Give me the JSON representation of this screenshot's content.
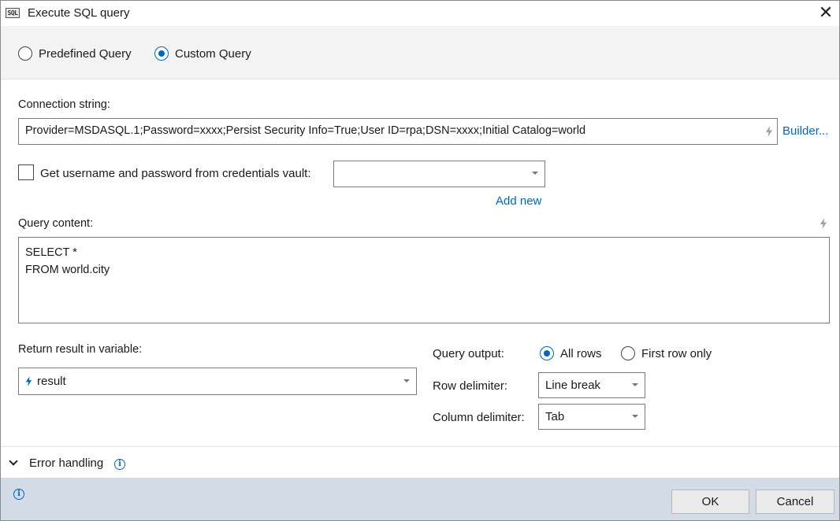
{
  "window": {
    "icon_text": "SQL",
    "title": "Execute SQL query",
    "close_glyph": "✕"
  },
  "mode": {
    "options": [
      {
        "label": "Predefined Query",
        "checked": false
      },
      {
        "label": "Custom Query",
        "checked": true
      }
    ]
  },
  "connection": {
    "label": "Connection string:",
    "value": "Provider=MSDASQL.1;Password=xxxx;Persist Security Info=True;User ID=rpa;DSN=xxxx;Initial Catalog=world",
    "builder_label": "Builder..."
  },
  "credentials": {
    "checkbox_label": "Get username and password from credentials vault:",
    "checked": false,
    "selected": "",
    "add_new_label": "Add new"
  },
  "query": {
    "label": "Query content:",
    "content": "SELECT *\nFROM world.city"
  },
  "result": {
    "label": "Return result in variable:",
    "variable": "result"
  },
  "output": {
    "label": "Query output:",
    "options": [
      {
        "label": "All rows",
        "checked": true
      },
      {
        "label": "First row only",
        "checked": false
      }
    ],
    "row_delimiter_label": "Row delimiter:",
    "row_delimiter": "Line break",
    "column_delimiter_label": "Column delimiter:",
    "column_delimiter": "Tab"
  },
  "error_handling": {
    "label": "Error handling"
  },
  "footer": {
    "ok_label": "OK",
    "cancel_label": "Cancel"
  },
  "colors": {
    "accent": "#0067c0",
    "footer_bg": "#d2dbe6",
    "mode_bar_bg": "#f3f3f3"
  },
  "icons": {
    "variable_marker": "lightning-bolt-icon",
    "info": "info-circle-icon",
    "expand": "chevron-down-icon"
  }
}
